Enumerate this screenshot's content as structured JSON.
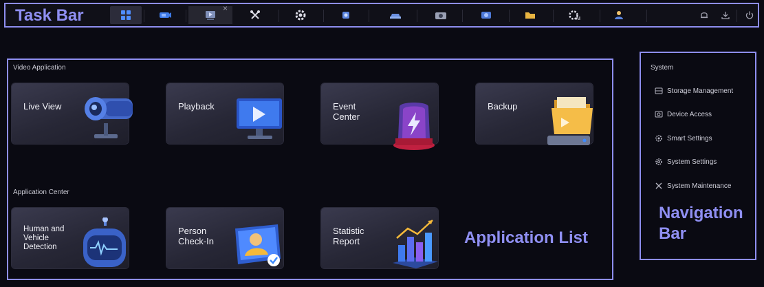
{
  "taskbar": {
    "title": "Task Bar",
    "items": [
      {
        "name": "home-grid-icon"
      },
      {
        "name": "live-view-icon"
      },
      {
        "name": "playback-icon"
      },
      {
        "name": "maintenance-tools-icon"
      },
      {
        "name": "settings-gear-icon"
      },
      {
        "name": "event-center-icon"
      },
      {
        "name": "human-vehicle-icon"
      },
      {
        "name": "camera-icon"
      },
      {
        "name": "device-access-icon"
      },
      {
        "name": "backup-folder-icon"
      },
      {
        "name": "smart-settings-ai-icon"
      },
      {
        "name": "person-checkin-icon"
      }
    ],
    "close_glyph": "×",
    "right_icons": [
      "bell-icon",
      "download-icon",
      "power-icon"
    ]
  },
  "app_list": {
    "title": "Application List",
    "video_section": "Video Application",
    "video_apps": [
      {
        "label": "Live View"
      },
      {
        "label": "Playback"
      },
      {
        "label": "Event\nCenter"
      },
      {
        "label": "Backup"
      }
    ],
    "center_section": "Application Center",
    "center_apps": [
      {
        "label": "Human and\nVehicle\nDetection"
      },
      {
        "label": "Person\nCheck-In"
      },
      {
        "label": "Statistic\nReport"
      }
    ]
  },
  "nav": {
    "title": "Navigation\nBar",
    "section": "System",
    "items": [
      {
        "label": "Storage Management"
      },
      {
        "label": "Device Access"
      },
      {
        "label": "Smart Settings"
      },
      {
        "label": "System Settings"
      },
      {
        "label": "System Maintenance"
      }
    ]
  },
  "colors": {
    "annotation": "#8f8ff2",
    "background": "#0a0a12",
    "tile": "#2c2c3c",
    "accent_blue": "#3e8bff"
  }
}
